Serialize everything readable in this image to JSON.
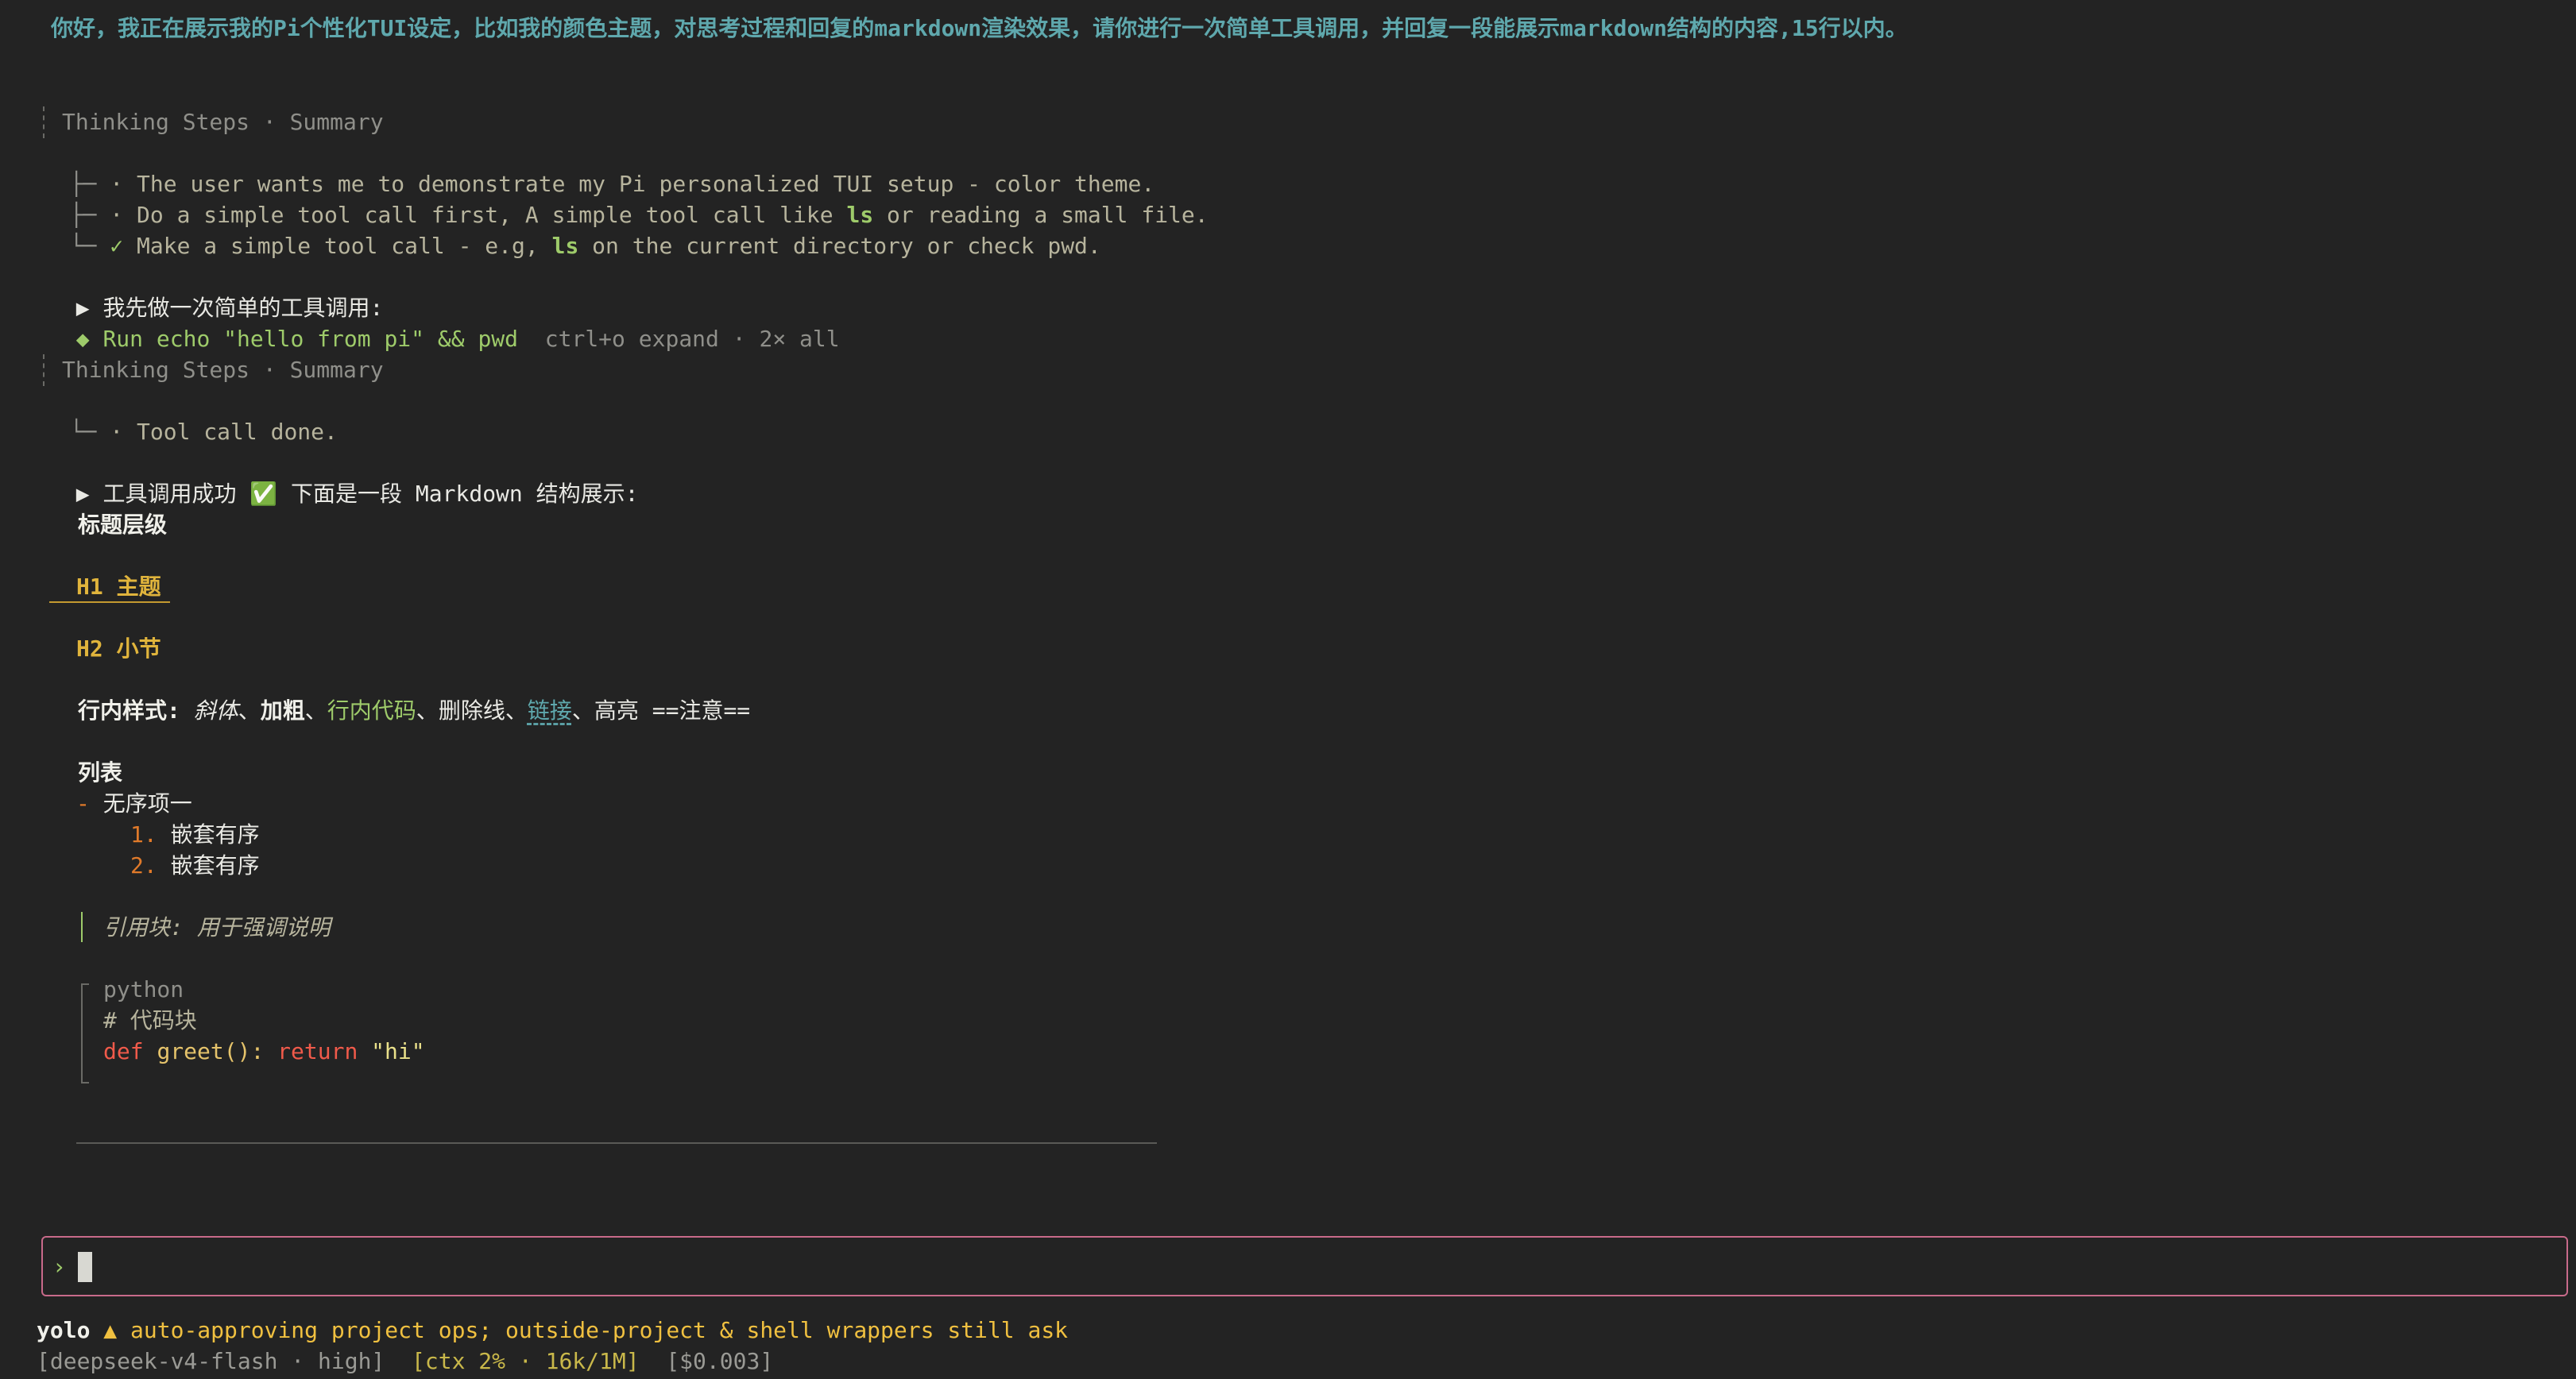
{
  "user_prompt": "你好，我正在展示我的Pi个性化TUI设定，比如我的颜色主题，对思考过程和回复的markdown渲染效果，请你进行一次简单工具调用，并回复一段能展示markdown结构的内容,15行以内。",
  "thinking1": {
    "title": "Thinking Steps · Summary",
    "steps": [
      {
        "prefix": "├─",
        "bullet": "·",
        "pre": "The user wants me to demonstrate my Pi personalized TUI setup - color theme.",
        "code": "",
        "post": ""
      },
      {
        "prefix": "├─",
        "bullet": "·",
        "pre": "Do a simple tool call first, A simple tool call like ",
        "code": "ls",
        "post": " or reading a small file."
      },
      {
        "prefix": "└─",
        "bullet": "✓",
        "pre": "Make a simple tool call - e.g, ",
        "code": "ls",
        "post": " on the current directory or check pwd."
      }
    ]
  },
  "assistant1": "我先做一次简单的工具调用:",
  "tool_call": {
    "command": "Run echo \"hello from pi\" && pwd",
    "hint": "ctrl+o expand · 2× all"
  },
  "thinking2": {
    "title": "Thinking Steps · Summary",
    "step": "Tool call done."
  },
  "assistant2": {
    "pre": "工具调用成功",
    "emoji": "✅",
    "post": "下面是一段 Markdown 结构展示:"
  },
  "markdown": {
    "section1": "标题层级",
    "h1": "H1 主题",
    "h2": "H2 小节",
    "inline_label": "行内样式:",
    "italic": "斜体",
    "sep": "、",
    "bold": "加粗",
    "code": "行内代码",
    "strike": "删除线",
    "link": "链接",
    "highlight_pre": "高亮 ",
    "highlight": "==注意==",
    "list_title": "列表",
    "ul_marker": "-",
    "ul_item": "无序项一",
    "ol": [
      {
        "num": "1.",
        "text": "嵌套有序"
      },
      {
        "num": "2.",
        "text": "嵌套有序"
      }
    ],
    "quote": "引用块: 用于强调说明",
    "code_lang": "python",
    "code_comment": "# 代码块",
    "code_kw1": "def",
    "code_fn": "greet():",
    "code_kw2": "return",
    "code_str": "\"hi\""
  },
  "input": {
    "chevron": "›",
    "value": ""
  },
  "status": {
    "mode": "yolo",
    "warn_icon": "▲",
    "warn_text": "auto-approving project ops; outside-project & shell wrappers still ask",
    "model": "[deepseek-v4-flash · high]",
    "ctx": "[ctx 2% · 16k/1M]",
    "cost": "[$0.003]"
  },
  "colors": {
    "accent": "#5fa8ad",
    "success": "#9ecb6a",
    "heading": "#e0b43c",
    "input_border": "#c86a8a"
  }
}
